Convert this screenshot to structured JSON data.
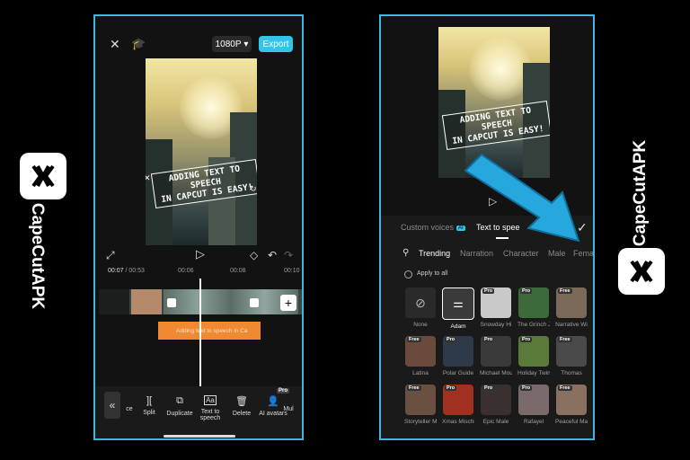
{
  "brand": {
    "name": "CapeCutAPK",
    "logo_glyph": "⌬"
  },
  "editor": {
    "resolution": "1080P",
    "export_label": "Export",
    "caption_text": "ADDING TEXT TO SPEECH\nIN CAPCUT IS EASY!",
    "time_current": "00:07",
    "time_total": "/ 00:53",
    "ruler_marks": [
      "00:06",
      "00:08",
      "00:10"
    ],
    "tts_clip_text": "Adding text to speech in Ca",
    "toolbar": [
      {
        "label": "ce",
        "icon": ""
      },
      {
        "label": "Split",
        "icon": "]["
      },
      {
        "label": "Duplicate",
        "icon": "⧉"
      },
      {
        "label": "Text to speech",
        "icon": "Aa"
      },
      {
        "label": "Delete",
        "icon": "🗑"
      },
      {
        "label": "AI avatars",
        "icon": "👤"
      },
      {
        "label": "Mul",
        "icon": ""
      }
    ],
    "pro_badge": "Pro"
  },
  "tts": {
    "caption_text": "ADDING TEXT TO SPEECH\nIN CAPCUT IS EASY!",
    "tabs": [
      {
        "label": "Custom voices",
        "badge": "AI"
      },
      {
        "label": "Text to spee",
        "active": true
      }
    ],
    "filters": [
      "Trending",
      "Narration",
      "Character",
      "Male",
      "Femal"
    ],
    "apply_all": "Apply to all",
    "voices": [
      {
        "name": "None",
        "badge": ""
      },
      {
        "name": "Adam",
        "badge": ""
      },
      {
        "name": "Snowday Hi",
        "badge": "Pro"
      },
      {
        "name": "The Grinch J",
        "badge": "Pro"
      },
      {
        "name": "Narrative Wi",
        "badge": "Free"
      },
      {
        "name": "Latina",
        "badge": "Free"
      },
      {
        "name": "Polar Guide",
        "badge": "Pro"
      },
      {
        "name": "Michael Mou",
        "badge": "Pro"
      },
      {
        "name": "Holiday Twin",
        "badge": "Pro"
      },
      {
        "name": "Thomas",
        "badge": "Free"
      },
      {
        "name": "Storyteller M",
        "badge": "Free"
      },
      {
        "name": "Xmas Mischi",
        "badge": "Pro"
      },
      {
        "name": "Epic Male",
        "badge": "Pro"
      },
      {
        "name": "Rafayel",
        "badge": "Pro"
      },
      {
        "name": "Peaceful Ma",
        "badge": "Free"
      }
    ]
  },
  "colors": {
    "accent": "#31c6e8",
    "clip": "#f08a32",
    "frame": "#3fb6e0"
  }
}
